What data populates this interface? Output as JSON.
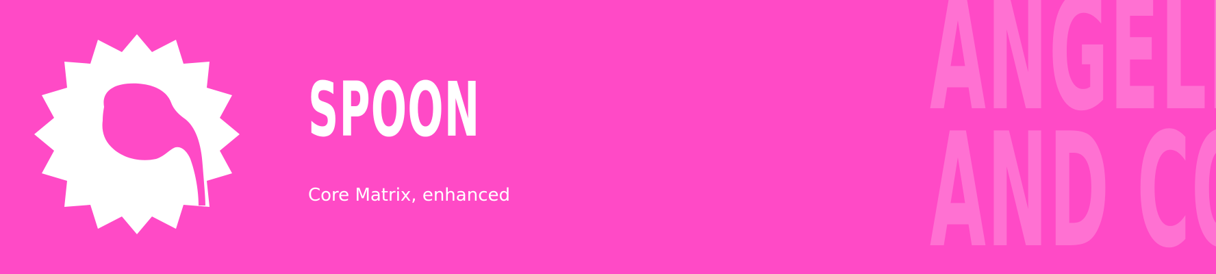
{
  "banner": {
    "background_color": "#FF4AC6",
    "foreground_color": "#FFFFFF",
    "logo_icon": "starburst-speech-bubble-icon",
    "title": "SPOON",
    "subtitle": "Core Matrix, enhanced",
    "brand_mark": {
      "line1": "ANGELL",
      "line2": "AND CO"
    }
  }
}
